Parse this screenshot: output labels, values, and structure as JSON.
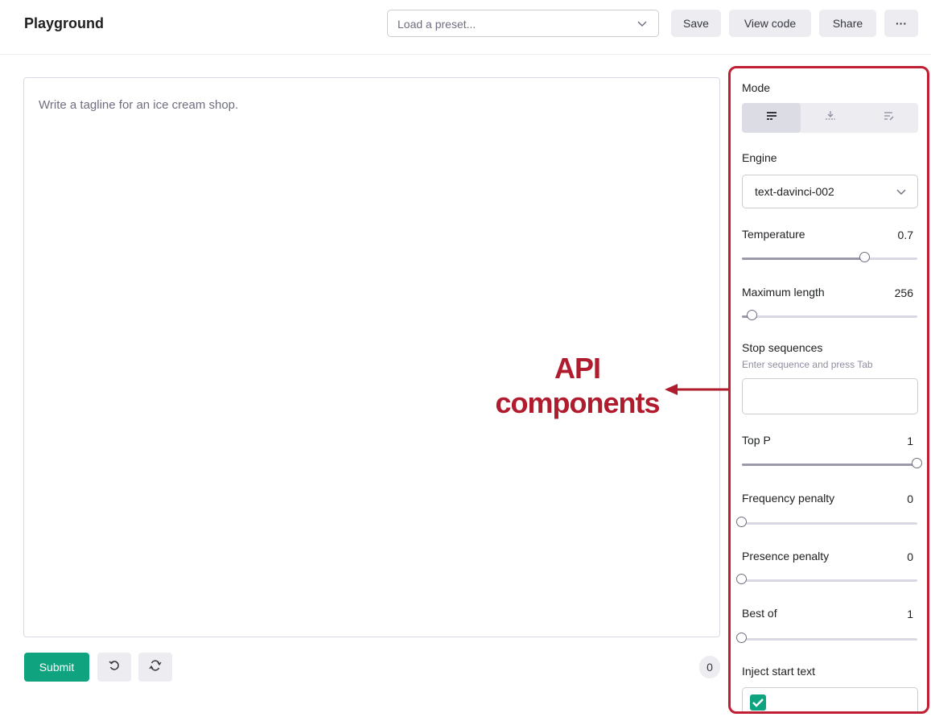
{
  "header": {
    "title": "Playground",
    "preset_placeholder": "Load a preset...",
    "save_label": "Save",
    "view_code_label": "View code",
    "share_label": "Share",
    "more_label": "···"
  },
  "editor": {
    "placeholder": "Write a tagline for an ice cream shop.",
    "submit_label": "Submit",
    "undo_icon": "undo-icon",
    "regenerate_icon": "regenerate-icon",
    "token_count": "0"
  },
  "annotation": {
    "line1": "API",
    "line2": "components",
    "color": "#b01c2e"
  },
  "panel": {
    "mode_label": "Mode",
    "mode_options": [
      "complete-icon",
      "insert-icon",
      "edit-icon"
    ],
    "engine_label": "Engine",
    "engine_value": "text-davinci-002",
    "temperature": {
      "label": "Temperature",
      "value": "0.7",
      "level": 0.7
    },
    "max_length": {
      "label": "Maximum length",
      "value": "256",
      "level": 0.06
    },
    "stop_sequences": {
      "label": "Stop sequences",
      "hint": "Enter sequence and press Tab"
    },
    "top_p": {
      "label": "Top P",
      "value": "1",
      "level": 1.0
    },
    "frequency_penalty": {
      "label": "Frequency penalty",
      "value": "0",
      "level": 0
    },
    "presence_penalty": {
      "label": "Presence penalty",
      "value": "0",
      "level": 0
    },
    "best_of": {
      "label": "Best of",
      "value": "1",
      "level": 0
    },
    "inject_start_text": {
      "label": "Inject start text",
      "checked": true
    }
  },
  "colors": {
    "accent": "#10a37f",
    "highlight": "#c01e33"
  }
}
